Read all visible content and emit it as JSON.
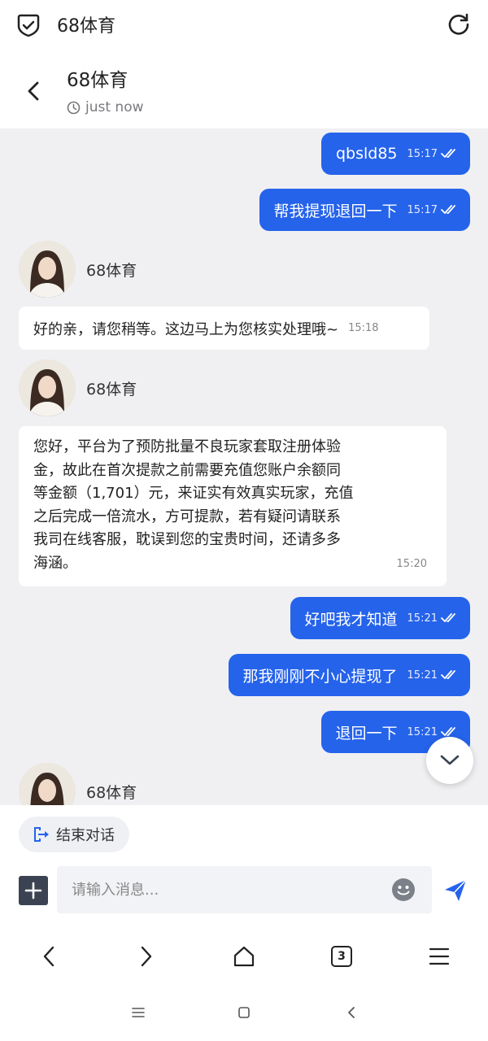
{
  "topbar": {
    "app_title": "68体育"
  },
  "chat_header": {
    "title": "68体育",
    "status": "just now"
  },
  "messages": [
    {
      "side": "out",
      "text": "qbsld85",
      "time": "15:17"
    },
    {
      "side": "out",
      "text": "帮我提现退回一下",
      "time": "15:17"
    },
    {
      "side": "agent",
      "name": "68体育"
    },
    {
      "side": "in",
      "text": "好的亲，请您稍等。这边马上为您核实处理哦~",
      "time": "15:18"
    },
    {
      "side": "agent",
      "name": "68体育"
    },
    {
      "side": "in",
      "lines": [
        "您好，平台为了预防批量不良玩家套取注册体验",
        "金，故此在首次提款之前需要充值您账户余额同",
        "等金额（1,701）元，来证实有效真实玩家，充值",
        "之后完成一倍流水，方可提款，若有疑问请联系",
        "我司在线客服，耽误到您的宝贵时间，还请多多",
        "海涵。"
      ],
      "time": "15:20"
    },
    {
      "side": "out",
      "text": "好吧我才知道",
      "time": "15:21"
    },
    {
      "side": "out",
      "text": "那我刚刚不小心提现了",
      "time": "15:21"
    },
    {
      "side": "out",
      "text": "退回一下",
      "time": "15:21"
    },
    {
      "side": "agent",
      "name": "68体育"
    }
  ],
  "composer": {
    "end_chat_label": "结束对话",
    "placeholder": "请输入消息..."
  },
  "browser_nav": {
    "tab_count": "3"
  },
  "icons": [
    "shield-check-icon",
    "refresh-icon",
    "back-chevron-icon",
    "clock-icon",
    "double-check-icon",
    "chevron-down-icon",
    "exit-icon",
    "plus-icon",
    "emoji-icon",
    "send-icon",
    "tabs-icon",
    "home-icon",
    "menu-icon"
  ],
  "colors": {
    "accent": "#2563eb",
    "background": "#f0f0f3"
  }
}
